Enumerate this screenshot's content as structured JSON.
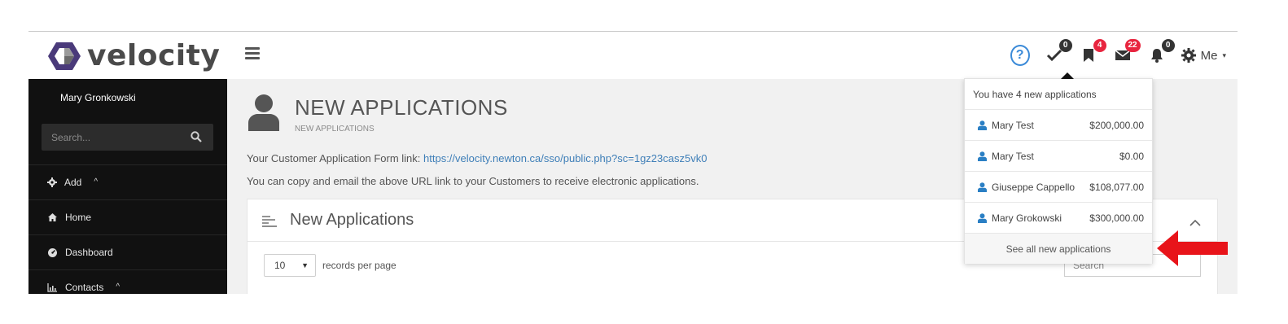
{
  "app": {
    "logo_text": "velocity",
    "brand_color": "#4a3a7a"
  },
  "header": {
    "help_symbol": "?",
    "tasks_badge": "0",
    "applications_badge": "4",
    "messages_badge": "22",
    "notifications_badge": "0",
    "me_label": "Me"
  },
  "sidebar": {
    "user_name": "Mary Gronkowski",
    "search_placeholder": "Search...",
    "items": [
      {
        "label": "Add",
        "icon": "gear-icon"
      },
      {
        "label": "Home",
        "icon": "home-icon"
      },
      {
        "label": "Dashboard",
        "icon": "dashboard-icon"
      },
      {
        "label": "Contacts",
        "icon": "chart-icon"
      }
    ]
  },
  "main": {
    "title": "NEW APPLICATIONS",
    "subtitle": "NEW APPLICATIONS",
    "link_prefix": "Your Customer Application Form link: ",
    "link_url": "https://velocity.newton.ca/sso/public.php?sc=1gz23casz5vk0",
    "copy_text": "You can copy and email the above URL link to your Customers to receive electronic applications.",
    "panel_title": "New Applications",
    "page_size": "10",
    "records_label": "records per page",
    "search_placeholder": "Search"
  },
  "dropdown": {
    "header": "You have 4 new applications",
    "items": [
      {
        "name": "Mary Test",
        "amount": "$200,000.00"
      },
      {
        "name": "Mary Test",
        "amount": "$0.00"
      },
      {
        "name": "Giuseppe Cappello",
        "amount": "$108,077.00"
      },
      {
        "name": "Mary Grokowski",
        "amount": "$300,000.00"
      }
    ],
    "footer": "See all new applications"
  },
  "colors": {
    "sidebar_bg": "#111111",
    "link": "#3f7fb8",
    "badge_red": "#e8253f",
    "annotation_arrow": "#e8141a",
    "user_icon": "#2a7fc4"
  }
}
